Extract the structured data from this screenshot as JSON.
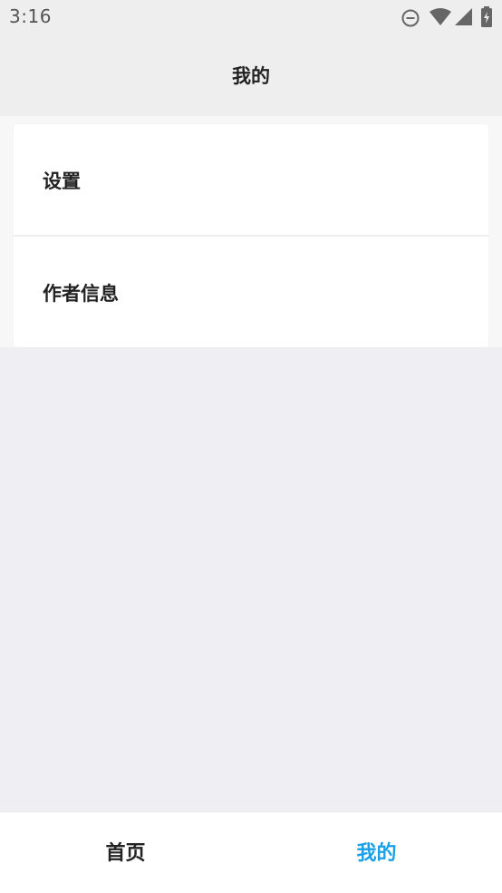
{
  "status_bar": {
    "time": "3:16",
    "icons": [
      "do-not-disturb-icon",
      "wifi-icon",
      "signal-icon",
      "battery-charging-icon"
    ]
  },
  "header": {
    "title": "我的"
  },
  "menu": {
    "items": [
      {
        "label": "设置"
      },
      {
        "label": "作者信息"
      }
    ]
  },
  "bottom_nav": {
    "tabs": [
      {
        "label": "首页",
        "active": false
      },
      {
        "label": "我的",
        "active": true
      }
    ],
    "active_color": "#1aa0e8"
  },
  "colors": {
    "background": "#efeff3",
    "header_background": "#eeeeee",
    "card_background": "#ffffff",
    "text": "#222222"
  }
}
